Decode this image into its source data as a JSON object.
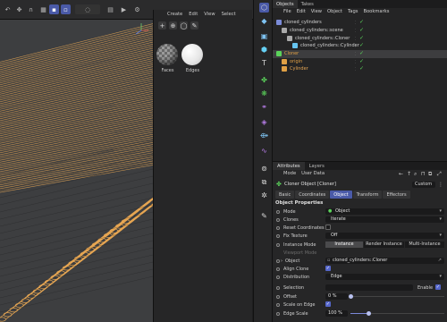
{
  "colors": {
    "accent": "#4a5aa8",
    "check_green": "#5bd35b",
    "cloner_orange": "#e0a045",
    "cylinder_orange": "#e6a653"
  },
  "matpanel": {
    "menu": [
      "Create",
      "Edit",
      "View",
      "Select"
    ],
    "tools": [
      "plus-icon",
      "add-material-icon",
      "circle-icon",
      "eyedropper-icon"
    ],
    "materials": [
      {
        "label": "Faces",
        "style": "checker"
      },
      {
        "label": "Edges",
        "style": "white"
      }
    ]
  },
  "objects": {
    "tabs": [
      "Objects",
      "Takes"
    ],
    "menu": [
      "File",
      "Edit",
      "View",
      "Object",
      "Tags",
      "Bookmarks"
    ],
    "rows": [
      {
        "name": "cloned_cylinders",
        "icon_color": "#7b8bd8",
        "indent": 0,
        "check": true
      },
      {
        "name": "cloned_cylinders::scene",
        "icon_color": "#aaaaaa",
        "indent": 1,
        "check": true
      },
      {
        "name": "cloned_cylinders::Cloner",
        "icon_color": "#aaaaaa",
        "indent": 2,
        "check": true
      },
      {
        "name": "cloned_cylinders::Cylinder",
        "icon_color": "#66c4f0",
        "indent": 3,
        "check": true
      },
      {
        "name": "Cloner",
        "icon_color": "#5bd35b",
        "indent": 0,
        "check": true,
        "selected": true,
        "name_color": "#e0a045"
      },
      {
        "name": "origin",
        "icon_color": "#e0a045",
        "indent": 1,
        "check": true,
        "name_color": "#e0a045"
      },
      {
        "name": "Cylinder",
        "icon_color": "#e0a045",
        "indent": 1,
        "check": true,
        "name_color": "#e6a653"
      }
    ]
  },
  "attributes": {
    "tabs": [
      "Attributes",
      "Layers"
    ],
    "menu": [
      "Mode",
      "User Data"
    ],
    "object_title": "Cloner Object [Cloner]",
    "preset_label": "Custom",
    "subtabs": [
      "Basic",
      "Coordinates",
      "Object",
      "Transform",
      "Effectors"
    ],
    "active_subtab": "Object",
    "section_title": "Object Properties",
    "props": {
      "mode": {
        "label": "Mode",
        "value": "Object"
      },
      "clones": {
        "label": "Clones",
        "value": "Iterate"
      },
      "reset": {
        "label": "Reset Coordinates"
      },
      "fix": {
        "label": "Fix Texture",
        "value": "Off"
      },
      "instance": {
        "label": "Instance Mode",
        "options": [
          "Instance",
          "Render Instance",
          "Multi-Instance"
        ]
      },
      "viewport": {
        "label": "Viewport Mode"
      },
      "object": {
        "label": "Object",
        "value": "cloned_cylinders::Cloner"
      },
      "align": {
        "label": "Align Clone"
      },
      "distribution": {
        "label": "Distribution",
        "value": "Edge"
      },
      "selection": {
        "label": "Selection",
        "enable_label": "Enable"
      },
      "offset": {
        "label": "Offset",
        "value": "0 %",
        "fraction": 0.0
      },
      "scale_edge": {
        "label": "Scale on Edge"
      },
      "edge_scale": {
        "label": "Edge Scale",
        "value": "100 %",
        "fraction": 1.0
      }
    }
  }
}
